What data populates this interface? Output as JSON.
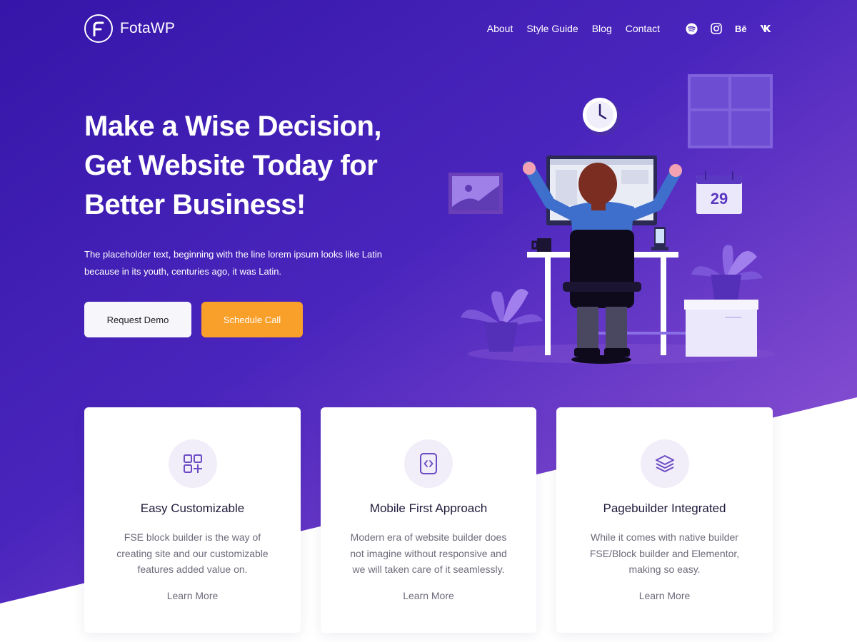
{
  "brand": {
    "name": "FotaWP",
    "logo_letter": "F"
  },
  "nav": {
    "items": [
      {
        "label": "About"
      },
      {
        "label": "Style Guide"
      },
      {
        "label": "Blog"
      },
      {
        "label": "Contact"
      }
    ],
    "social": [
      "spotify-icon",
      "instagram-icon",
      "behance-icon",
      "vk-icon"
    ]
  },
  "hero": {
    "title_line1": "Make a Wise Decision,",
    "title_line2": "Get Website Today for",
    "title_line3": "Better Business!",
    "description": "The placeholder text, beginning with the line lorem ipsum looks like Latin because in its youth, centuries ago, it was Latin.",
    "primary_button": "Request Demo",
    "secondary_button": "Schedule Call",
    "calendar_day": "29"
  },
  "features": [
    {
      "icon": "grid-plus-icon",
      "title": "Easy Customizable",
      "description": "FSE block builder is the way of creating site and our customizable features added value on.",
      "link": "Learn More"
    },
    {
      "icon": "code-file-icon",
      "title": "Mobile First Approach",
      "description": "Modern era of website builder does not imagine without responsive and we will taken care of it seamlessly.",
      "link": "Learn More"
    },
    {
      "icon": "layers-icon",
      "title": "Pagebuilder Integrated",
      "description": "While it comes with native builder FSE/Block builder and Elementor, making so easy.",
      "link": "Learn More"
    }
  ],
  "colors": {
    "hero_gradient_start": "#3a1fb0",
    "hero_gradient_end": "#8a55d6",
    "accent_orange": "#f9a02b",
    "light_button": "#f7f7fb",
    "card_title": "#1f1a3a",
    "card_text": "#6d6a7a"
  }
}
